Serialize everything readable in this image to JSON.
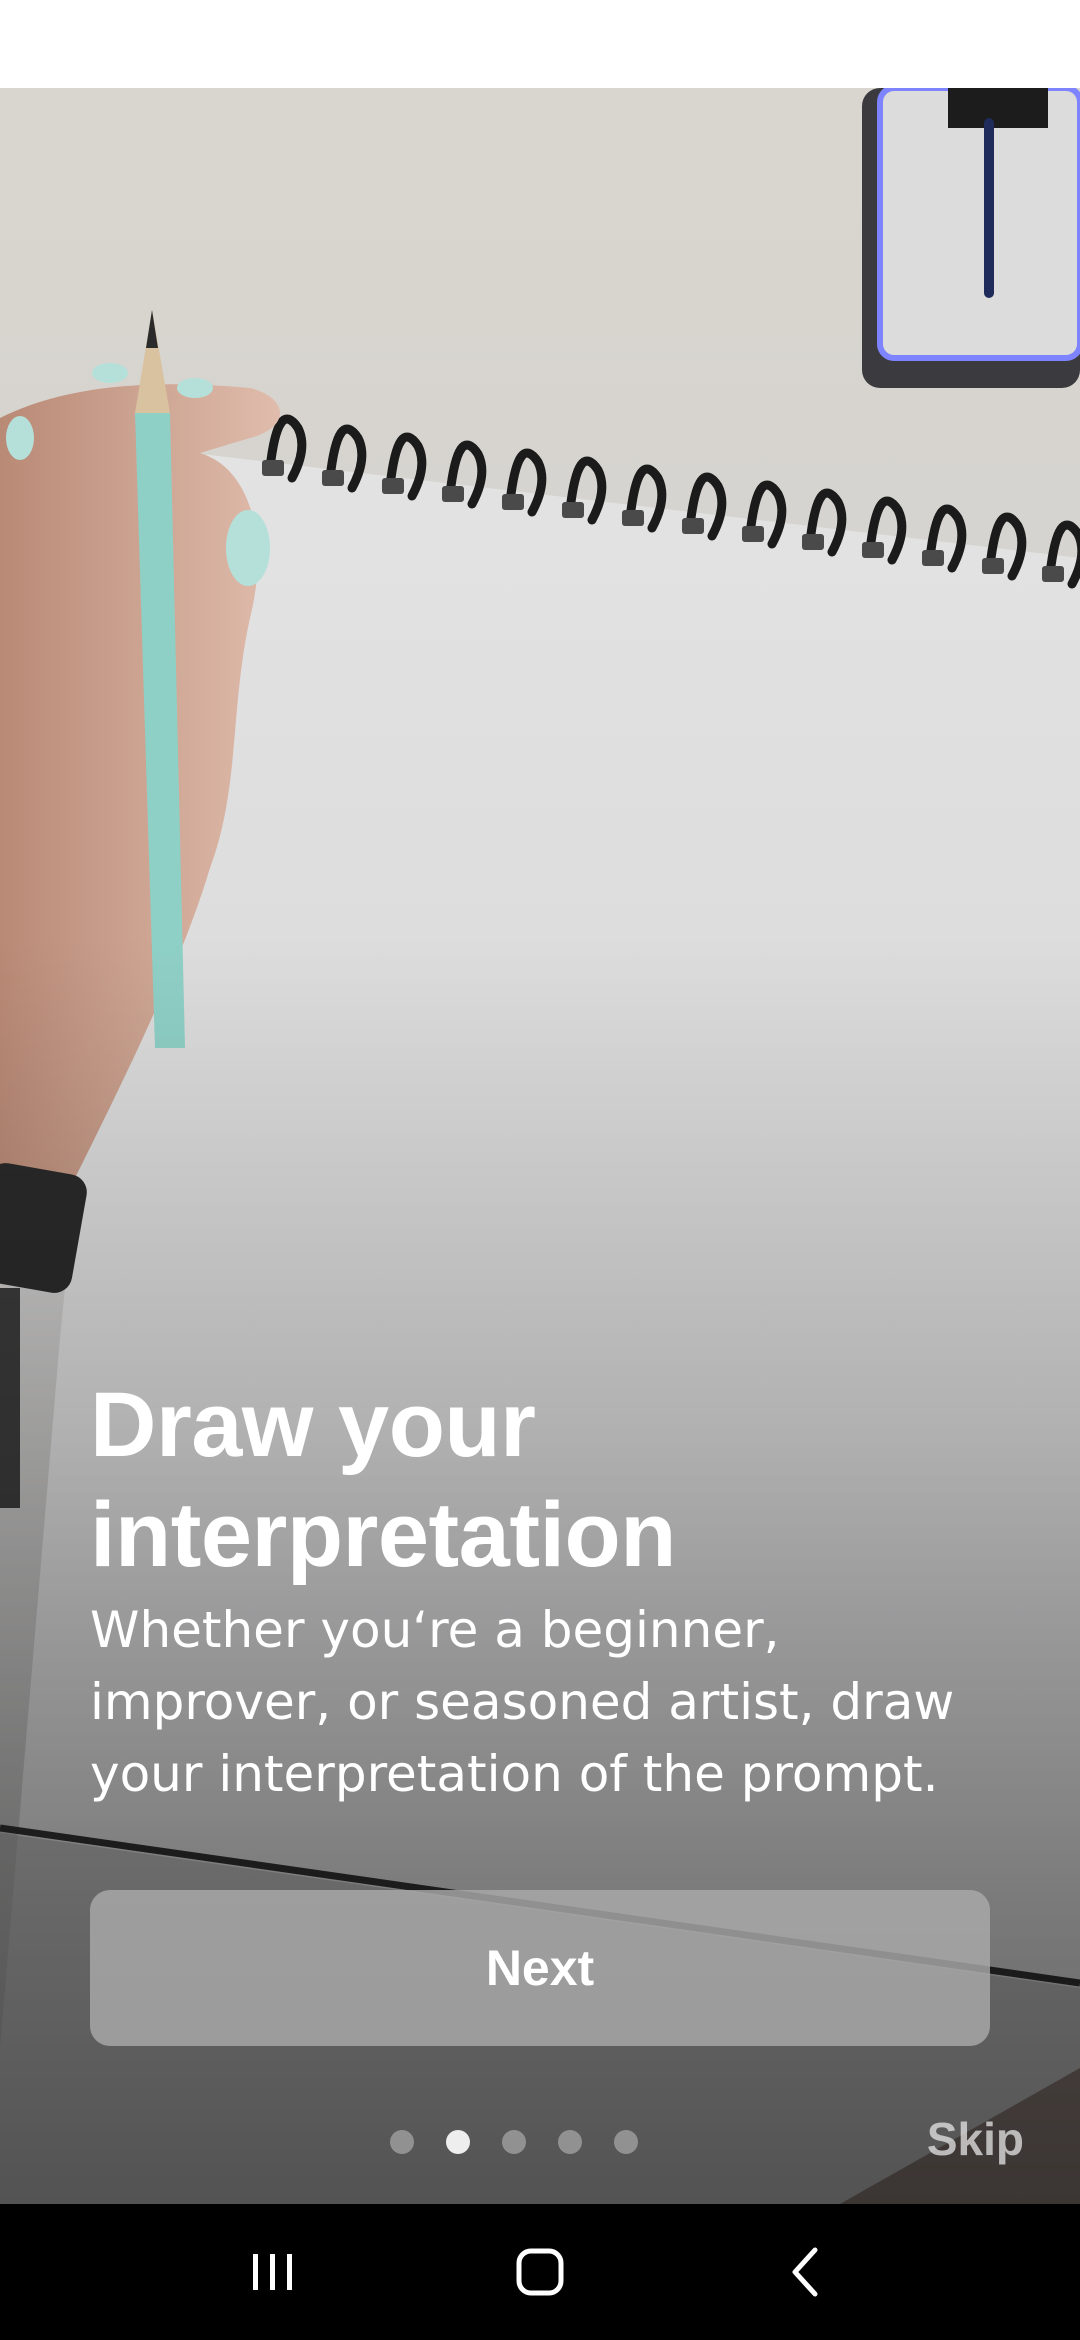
{
  "onboarding": {
    "title": "Draw your interpretation",
    "subtitle": "Whether you‘re a beginner, improver, or seasoned artist, draw your interpretation of the prompt.",
    "next_label": "Next",
    "skip_label": "Skip",
    "pager": {
      "total": 5,
      "active_index": 1
    }
  },
  "hero_image": {
    "description_icon": "notebook-pencil-photo"
  },
  "nav_bar": {
    "recents_icon": "recents-icon",
    "home_icon": "home-icon",
    "back_icon": "back-icon"
  },
  "colors": {
    "accent_pencil": "#8fd0c6",
    "nav_bar": "#000000",
    "button_bg": "#aaaaaa"
  }
}
